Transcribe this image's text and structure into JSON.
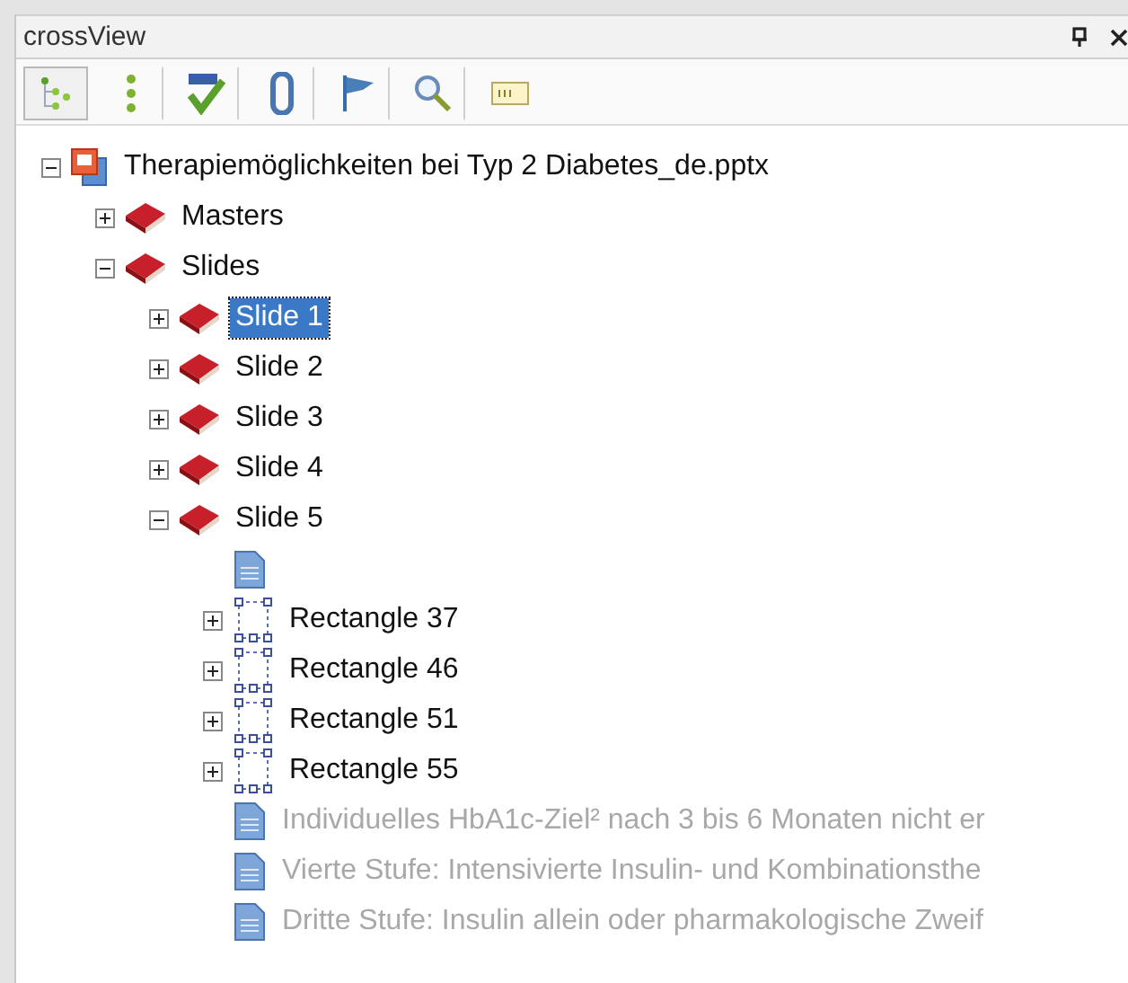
{
  "panel": {
    "title": "crossView"
  },
  "toolbar": [
    {
      "kind": "tree",
      "selected": true
    },
    {
      "kind": "dots",
      "selected": false
    },
    {
      "kind": "spell",
      "selected": false
    },
    {
      "kind": "clip",
      "selected": false
    },
    {
      "kind": "flag",
      "selected": false
    },
    {
      "kind": "search",
      "selected": false
    },
    {
      "kind": "field",
      "selected": false
    }
  ],
  "tree": [
    {
      "label": "Therapiemöglichkeiten bei Typ 2 Diabetes_de.pptx",
      "kind": "file",
      "expanded": true,
      "selected": false,
      "disabled": false,
      "children": [
        {
          "label": "Masters",
          "kind": "book",
          "expanded": false,
          "selected": false,
          "disabled": false
        },
        {
          "label": "Slides",
          "kind": "book",
          "expanded": true,
          "selected": false,
          "disabled": false,
          "children": [
            {
              "label": "Slide 1",
              "kind": "book",
              "expanded": false,
              "selected": true,
              "disabled": false
            },
            {
              "label": "Slide 2",
              "kind": "book",
              "expanded": false,
              "selected": false,
              "disabled": false
            },
            {
              "label": "Slide 3",
              "kind": "book",
              "expanded": false,
              "selected": false,
              "disabled": false
            },
            {
              "label": "Slide 4",
              "kind": "book",
              "expanded": false,
              "selected": false,
              "disabled": false
            },
            {
              "label": "Slide 5",
              "kind": "book",
              "expanded": true,
              "selected": false,
              "disabled": false,
              "children": [
                {
                  "kind": "text"
                },
                {
                  "label": "Rectangle 37",
                  "kind": "shape",
                  "expanded": false,
                  "selected": false,
                  "disabled": false
                },
                {
                  "label": "Rectangle 46",
                  "kind": "shape",
                  "expanded": false,
                  "selected": false,
                  "disabled": false
                },
                {
                  "label": "Rectangle 51",
                  "kind": "shape",
                  "expanded": false,
                  "selected": false,
                  "disabled": false
                },
                {
                  "label": "Rectangle 55",
                  "kind": "shape",
                  "expanded": false,
                  "selected": false,
                  "disabled": false
                },
                {
                  "label": "Individuelles HbA1c-Ziel² nach 3 bis 6 Monaten nicht er",
                  "kind": "text",
                  "selected": false,
                  "disabled": true
                },
                {
                  "label": "Vierte Stufe: Intensivierte Insulin- und Kombinationsthe",
                  "kind": "text",
                  "selected": false,
                  "disabled": true
                },
                {
                  "label": "Dritte Stufe: Insulin allein oder pharmakologische Zweif",
                  "kind": "text",
                  "selected": false,
                  "disabled": true
                }
              ]
            }
          ]
        }
      ]
    }
  ]
}
